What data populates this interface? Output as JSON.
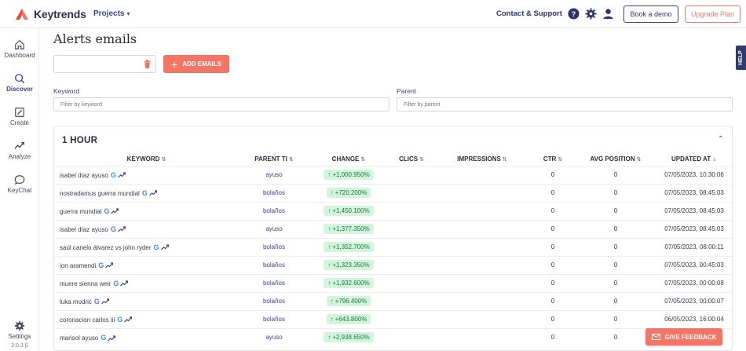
{
  "app": {
    "logo_text": "Keytrends",
    "projects_label": "Projects",
    "contact_label": "Contact & Support",
    "book_demo_label": "Book a demo",
    "upgrade_label": "Upgrade Plan",
    "brand_color": "#3b3f8f",
    "accent_color": "#f27565"
  },
  "sidebar": {
    "items": [
      {
        "label": "Dashboard",
        "icon": "home-icon"
      },
      {
        "label": "Discover",
        "icon": "search-icon"
      },
      {
        "label": "Create",
        "icon": "edit-icon"
      },
      {
        "label": "Analyze",
        "icon": "trend-icon"
      },
      {
        "label": "KeyChat",
        "icon": "chat-icon"
      }
    ],
    "settings_label": "Settings",
    "version": "2.0.3 β"
  },
  "main": {
    "title": "Alerts emails",
    "add_emails_label": "ADD EMAILS",
    "help_label": "HELP",
    "keyword_label": "Keyword",
    "keyword_placeholder": "Filter by keyword",
    "parent_label": "Parent",
    "parent_placeholder": "Filter by parent"
  },
  "card": {
    "title": "1 HOUR",
    "columns": [
      "KEYWORD",
      "PARENT TI",
      "CHANGE",
      "CLICS",
      "IMPRESSIONS",
      "CTR",
      "AVG POSITION",
      "UPDATED AT"
    ],
    "rows": [
      {
        "keyword": "isabel díaz ayuso",
        "parent": "ayuso",
        "change": "+1,000.950%",
        "clics": "",
        "impressions": "",
        "ctr": "0",
        "avg_position": "0",
        "updated_at": "07/05/2023, 10:30:06"
      },
      {
        "keyword": "nostradamus guerra mundial",
        "parent": "bolaños",
        "change": "+720.200%",
        "clics": "",
        "impressions": "",
        "ctr": "0",
        "avg_position": "0",
        "updated_at": "07/05/2023, 08:45:03"
      },
      {
        "keyword": "guerra mundial",
        "parent": "bolaños",
        "change": "+1,450.100%",
        "clics": "",
        "impressions": "",
        "ctr": "0",
        "avg_position": "0",
        "updated_at": "07/05/2023, 08:45:03"
      },
      {
        "keyword": "isabel díaz ayuso",
        "parent": "ayuso",
        "change": "+1,377.350%",
        "clics": "",
        "impressions": "",
        "ctr": "0",
        "avg_position": "0",
        "updated_at": "07/05/2023, 08:45:03"
      },
      {
        "keyword": "saúl canelo álvarez vs john ryder",
        "parent": "bolaños",
        "change": "+1,352.700%",
        "clics": "",
        "impressions": "",
        "ctr": "0",
        "avg_position": "0",
        "updated_at": "07/05/2023, 08:00:11"
      },
      {
        "keyword": "ion aramendi",
        "parent": "bolaños",
        "change": "+1,323.350%",
        "clics": "",
        "impressions": "",
        "ctr": "0",
        "avg_position": "0",
        "updated_at": "07/05/2023, 00:45:03"
      },
      {
        "keyword": "muere sienna weir",
        "parent": "bolaños",
        "change": "+1,932.600%",
        "clics": "",
        "impressions": "",
        "ctr": "0",
        "avg_position": "0",
        "updated_at": "07/05/2023, 00:00:08"
      },
      {
        "keyword": "luka modrić",
        "parent": "bolaños",
        "change": "+796.400%",
        "clics": "",
        "impressions": "",
        "ctr": "0",
        "avg_position": "0",
        "updated_at": "07/05/2023, 00:00:07"
      },
      {
        "keyword": "coronacion carlos iii",
        "parent": "bolaños",
        "change": "+643.800%",
        "clics": "",
        "impressions": "",
        "ctr": "0",
        "avg_position": "0",
        "updated_at": "06/05/2023, 16:00:04"
      },
      {
        "keyword": "marisol ayuso",
        "parent": "ayuso",
        "change": "+2,938.650%",
        "clics": "",
        "impressions": "",
        "ctr": "0",
        "avg_position": "0",
        "updated_at": ""
      }
    ]
  },
  "feedback_label": "GIVE FEEDBACK"
}
